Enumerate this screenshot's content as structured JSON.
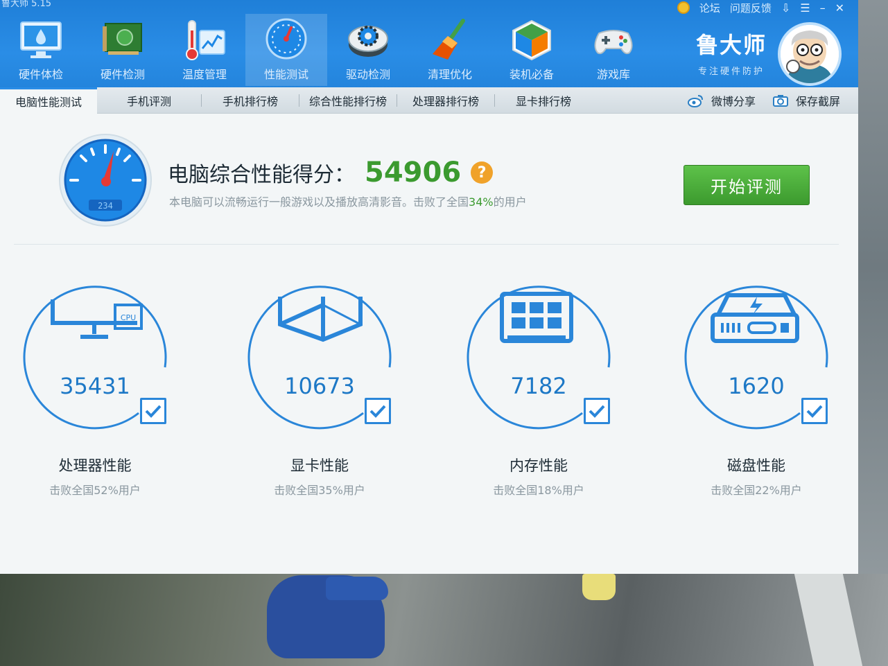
{
  "window": {
    "title": "鲁大师 5.15",
    "links": [
      "论坛",
      "问题反馈"
    ]
  },
  "nav": [
    {
      "label": "硬件体检",
      "icon": "monitor-health-icon"
    },
    {
      "label": "硬件检测",
      "icon": "circuit-board-icon"
    },
    {
      "label": "温度管理",
      "icon": "thermometer-icon"
    },
    {
      "label": "性能测试",
      "icon": "speedometer-icon"
    },
    {
      "label": "驱动检测",
      "icon": "gear-driver-icon"
    },
    {
      "label": "清理优化",
      "icon": "broom-icon"
    },
    {
      "label": "装机必备",
      "icon": "box-install-icon"
    },
    {
      "label": "游戏库",
      "icon": "gamepad-icon"
    }
  ],
  "brand": {
    "name": "鲁大师",
    "slogan": "专注硬件防护"
  },
  "tabs": [
    "电脑性能测试",
    "手机评测",
    "手机排行榜",
    "综合性能排行榜",
    "处理器排行榜",
    "显卡排行榜"
  ],
  "tools": {
    "weibo": "微博分享",
    "screenshot": "保存截屏"
  },
  "summary": {
    "gauge_text": "234",
    "title": "电脑综合性能得分：",
    "score": "54906",
    "help": "?",
    "desc_before": "本电脑可以流畅运行一般游戏以及播放高清影音。击败了全国",
    "desc_pct": "34%",
    "desc_after": "的用户",
    "start_button": "开始评测"
  },
  "metrics": [
    {
      "value": "35431",
      "name": "处理器性能",
      "sub": "击败全国52%用户",
      "icon": "cpu-monitor-icon"
    },
    {
      "value": "10673",
      "name": "显卡性能",
      "sub": "击败全国35%用户",
      "icon": "3d-cube-icon"
    },
    {
      "value": "7182",
      "name": "内存性能",
      "sub": "击败全国18%用户",
      "icon": "memory-chip-icon"
    },
    {
      "value": "1620",
      "name": "磁盘性能",
      "sub": "击败全国22%用户",
      "icon": "hard-disk-icon"
    }
  ],
  "colors": {
    "brand_blue": "#2a8de6",
    "score_green": "#3b9a2f",
    "metric_blue": "#1d78c6",
    "button_green": "#4cae3b"
  }
}
